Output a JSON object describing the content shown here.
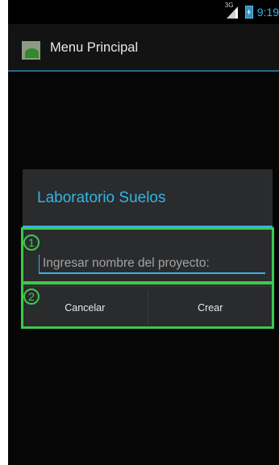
{
  "status_bar": {
    "network": "3G",
    "time": "9:19",
    "signal_icon": "signal-icon",
    "battery_icon": "battery-charging-icon"
  },
  "action_bar": {
    "title": "Menu Principal",
    "icon": "app-launcher-icon"
  },
  "dialog": {
    "title": "Laboratorio Suelos",
    "input_placeholder": "Ingresar nombre del proyecto:",
    "input_value": "",
    "cancel_label": "Cancelar",
    "create_label": "Crear"
  },
  "annotations": [
    {
      "number": "1"
    },
    {
      "number": "2"
    }
  ],
  "colors": {
    "accent": "#33b5e5",
    "annotation": "#3ec94b",
    "background": "#060606",
    "dialog": "#2a2b2d"
  }
}
